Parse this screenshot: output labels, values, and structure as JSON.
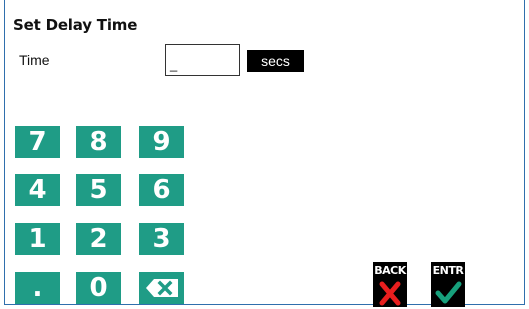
{
  "screen": {
    "title": "Set Delay Time",
    "time_label": "Time",
    "time_value": "_",
    "unit_label": "secs"
  },
  "keypad": {
    "keys": [
      "7",
      "8",
      "9",
      "4",
      "5",
      "6",
      "1",
      "2",
      "3",
      ".",
      "0"
    ],
    "backspace_icon": "backspace-icon"
  },
  "actions": {
    "back_label": "BACK",
    "back_icon": "red-x-icon",
    "enter_label": "ENTR",
    "enter_icon": "green-check-icon"
  },
  "colors": {
    "key_teal": "#1f9c86",
    "cancel_red": "#e81e1e",
    "confirm_green": "#17a07c",
    "frame_blue": "#2f6fad"
  }
}
